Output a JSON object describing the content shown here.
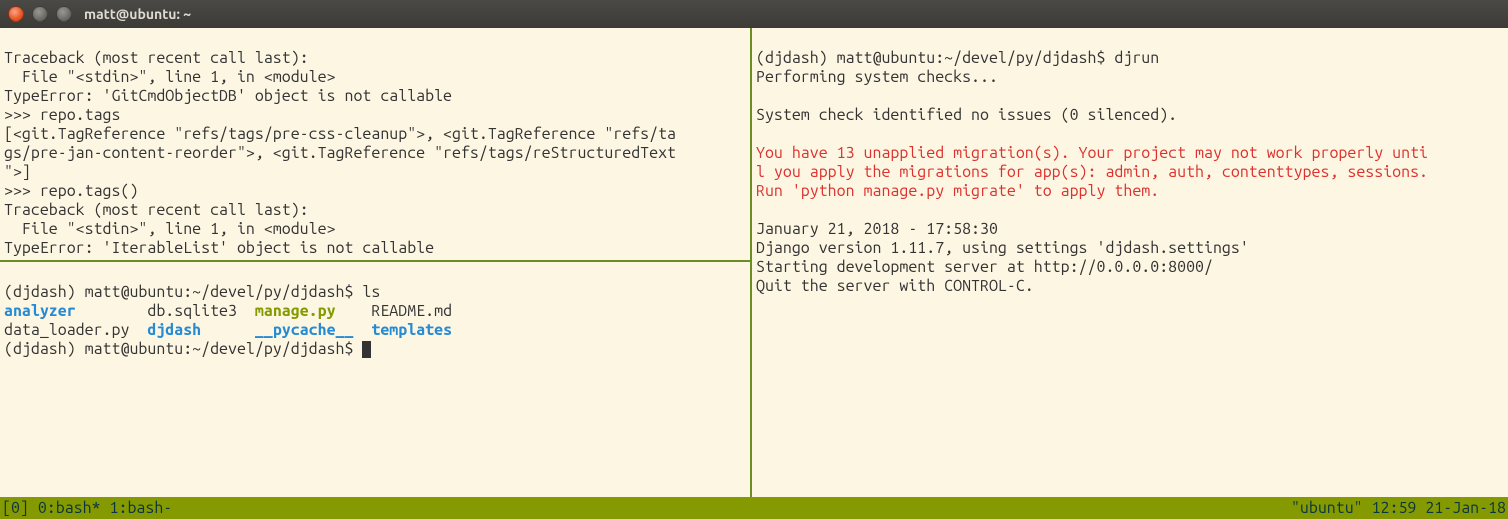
{
  "window": {
    "title": "matt@ubuntu: ~"
  },
  "pane_ul": {
    "l1": "Traceback (most recent call last):",
    "l2": "  File \"<stdin>\", line 1, in <module>",
    "l3": "TypeError: 'GitCmdObjectDB' object is not callable",
    "l4": ">>> repo.tags",
    "l5": "[<git.TagReference \"refs/tags/pre-css-cleanup\">, <git.TagReference \"refs/ta",
    "l6": "gs/pre-jan-content-reorder\">, <git.TagReference \"refs/tags/reStructuredText",
    "l7": "\">]",
    "l8": ">>> repo.tags()",
    "l9": "Traceback (most recent call last):",
    "l10": "  File \"<stdin>\", line 1, in <module>",
    "l11": "TypeError: 'IterableList' object is not callable",
    "l12": ">>> "
  },
  "pane_bl": {
    "prompt1": "(djdash) matt@ubuntu:~/devel/py/djdash$ ls",
    "ls": {
      "c1a": "analyzer",
      "c1b": "data_loader.py",
      "c2a": "db.sqlite3",
      "c2b": "djdash",
      "c3a": "manage.py",
      "c3b": "__pycache__",
      "c4a": "README.md",
      "c4b": "templates"
    },
    "prompt2": "(djdash) matt@ubuntu:~/devel/py/djdash$ "
  },
  "pane_r": {
    "l1": "(djdash) matt@ubuntu:~/devel/py/djdash$ djrun",
    "l2": "Performing system checks...",
    "l3": "",
    "l4": "System check identified no issues (0 silenced).",
    "l5": "",
    "e1": "You have 13 unapplied migration(s). Your project may not work properly unti",
    "e2": "l you apply the migrations for app(s): admin, auth, contenttypes, sessions.",
    "e3": "Run 'python manage.py migrate' to apply them.",
    "l6": "",
    "l7": "January 21, 2018 - 17:58:30",
    "l8": "Django version 1.11.7, using settings 'djdash.settings'",
    "l9": "Starting development server at http://0.0.0.0:8000/",
    "l10": "Quit the server with CONTROL-C."
  },
  "status": {
    "left": "[0] 0:bash* 1:bash-",
    "right": "\"ubuntu\" 12:59 21-Jan-18"
  }
}
